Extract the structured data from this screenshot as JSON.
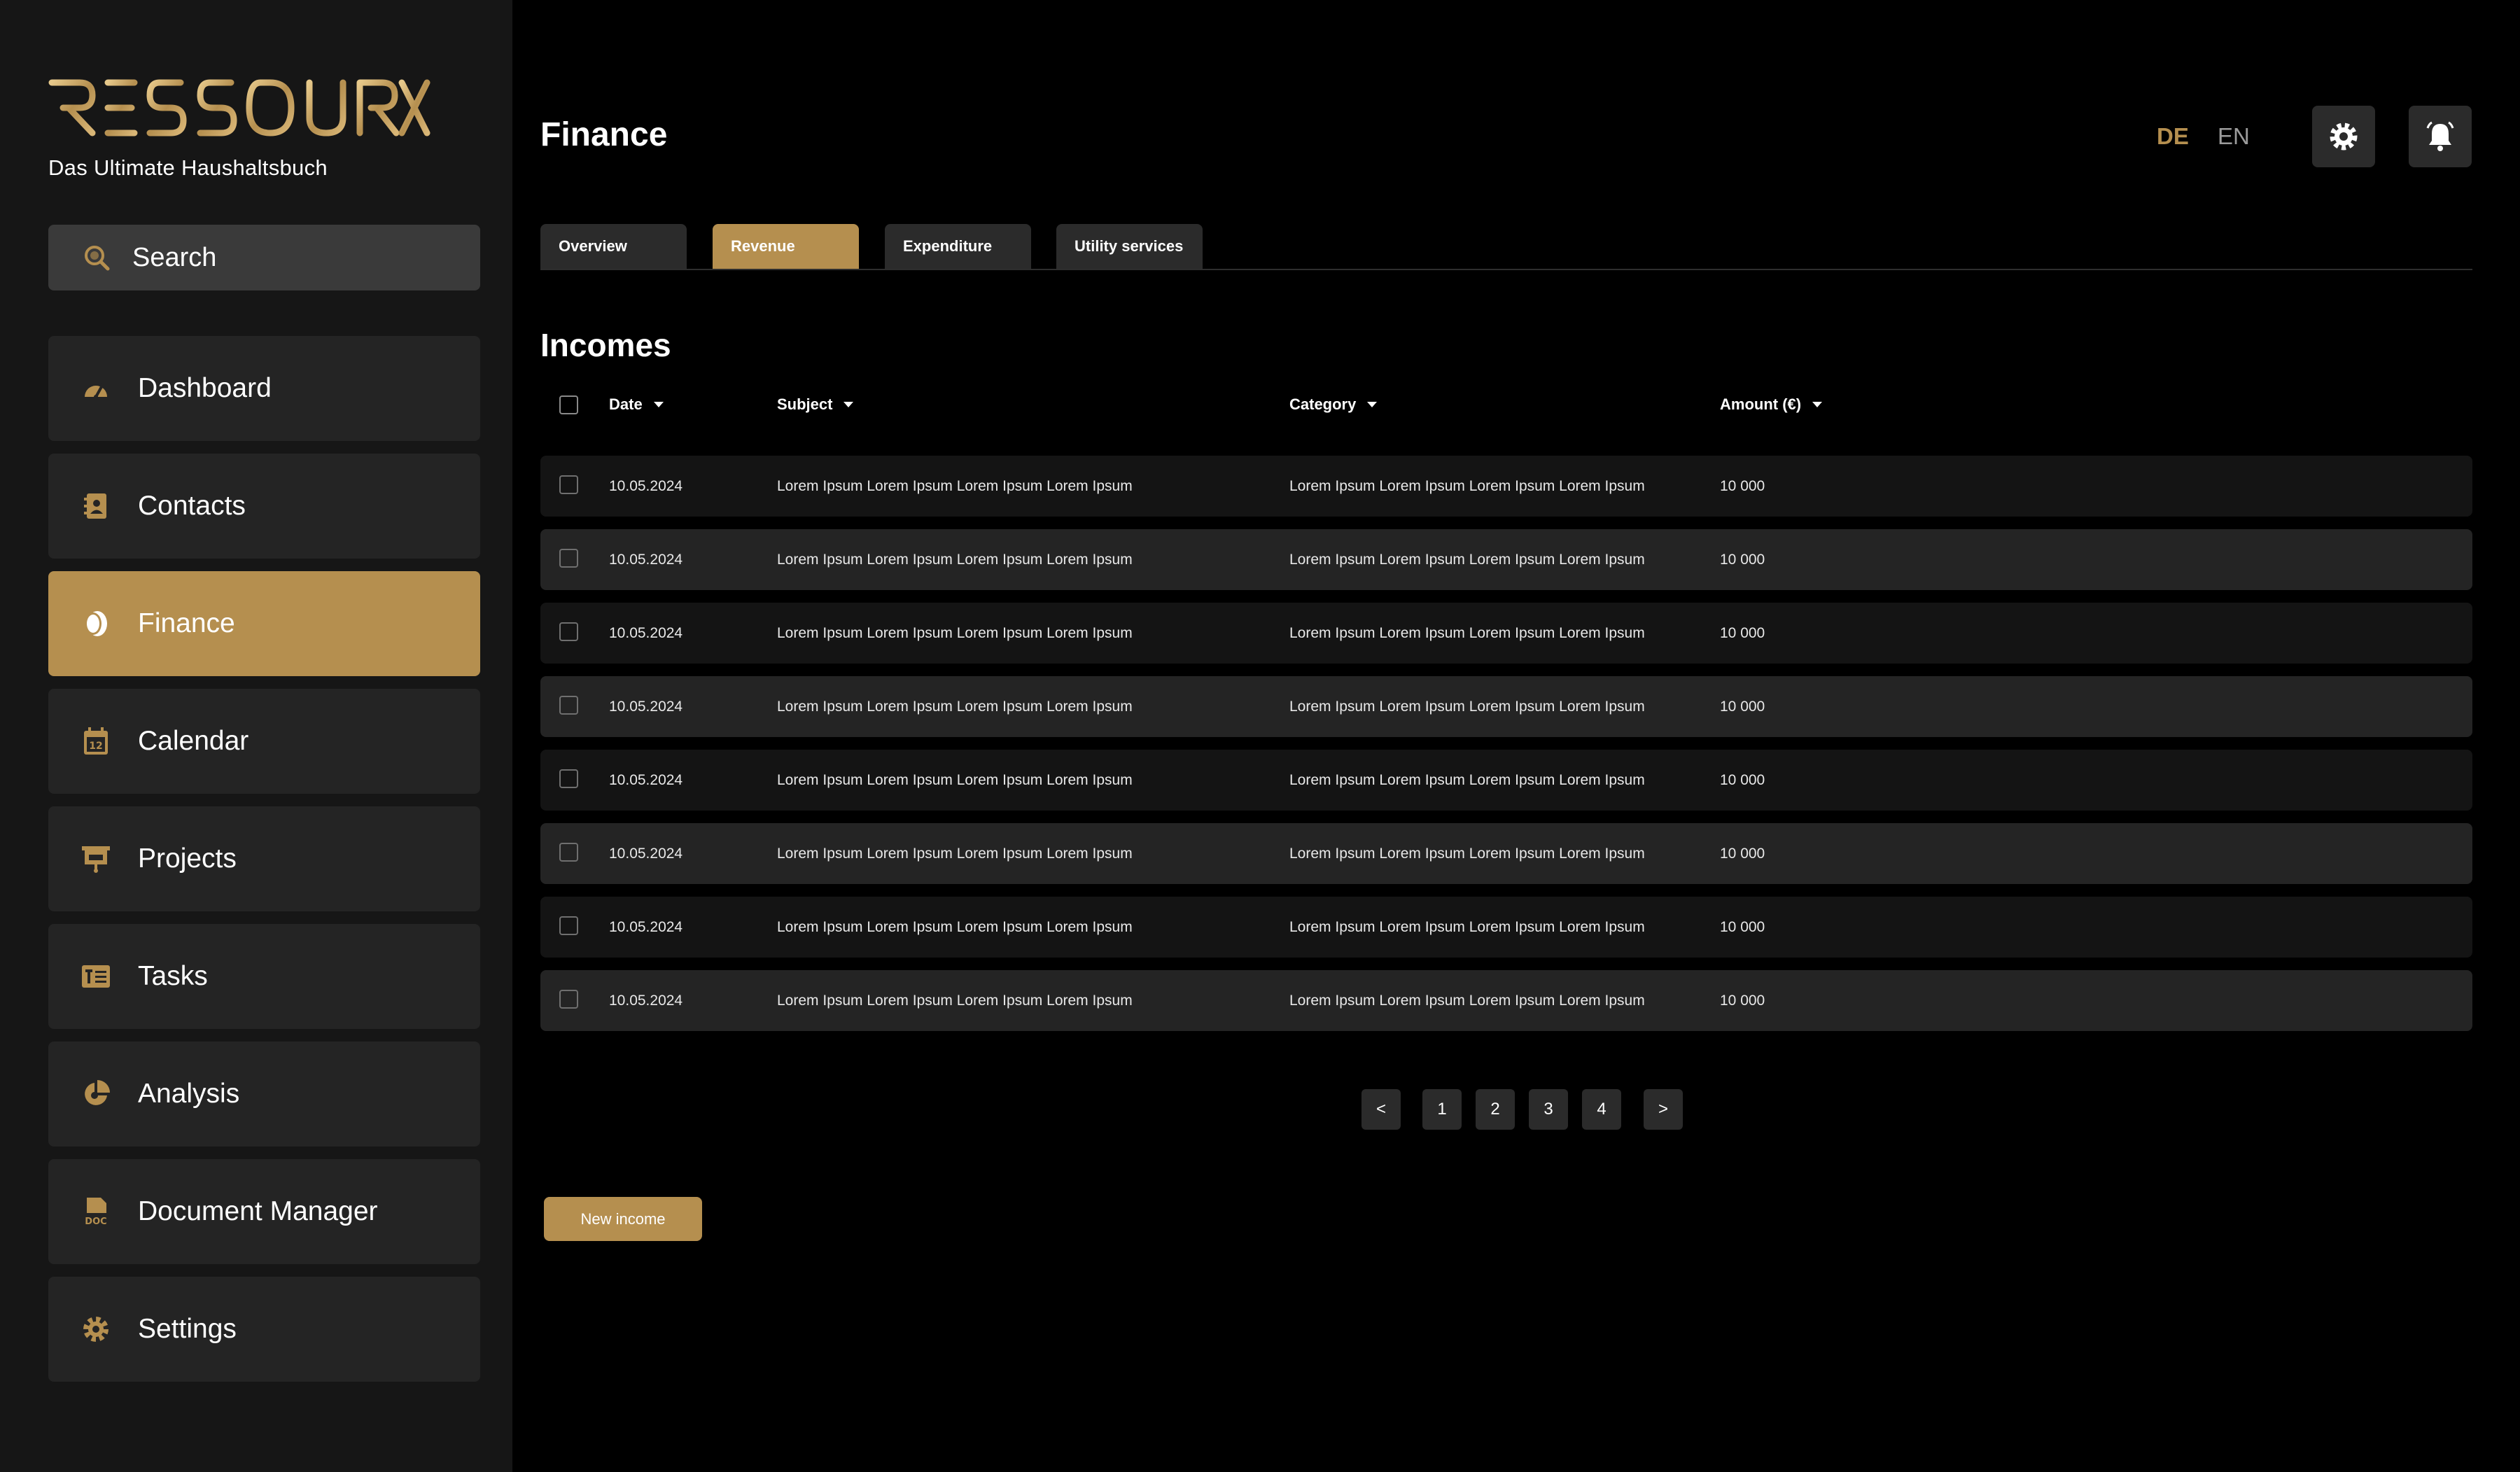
{
  "brand": {
    "logo_text": "RESSOURX",
    "tagline": "Das Ultimate Haushaltsbuch",
    "accent_color": "#b58f4f"
  },
  "search": {
    "label": "Search",
    "icon": "search-icon"
  },
  "sidebar": {
    "items": [
      {
        "label": "Dashboard",
        "icon": "dashboard-gauge-icon",
        "active": false
      },
      {
        "label": "Contacts",
        "icon": "contacts-book-icon",
        "active": false
      },
      {
        "label": "Finance",
        "icon": "finance-coins-icon",
        "active": true
      },
      {
        "label": "Calendar",
        "icon": "calendar-icon",
        "active": false
      },
      {
        "label": "Projects",
        "icon": "projects-board-icon",
        "active": false
      },
      {
        "label": "Tasks",
        "icon": "tasks-list-icon",
        "active": false
      },
      {
        "label": "Analysis",
        "icon": "analysis-pie-icon",
        "active": false
      },
      {
        "label": "Document Manager",
        "icon": "document-doc-icon",
        "active": false
      },
      {
        "label": "Settings",
        "icon": "settings-gear-icon",
        "active": false
      }
    ]
  },
  "header": {
    "title": "Finance",
    "lang_de": "DE",
    "lang_en": "EN",
    "active_lang": "DE",
    "settings_icon": "gear-icon",
    "notifications_icon": "bell-icon"
  },
  "tabs": [
    {
      "label": "Overview",
      "active": false
    },
    {
      "label": "Revenue",
      "active": true
    },
    {
      "label": "Expenditure",
      "active": false
    },
    {
      "label": "Utility services",
      "active": false
    }
  ],
  "section_title": "Incomes",
  "table": {
    "columns": [
      "Date",
      "Subject",
      "Category",
      "Amount (€)"
    ],
    "rows": [
      {
        "date": "10.05.2024",
        "subject": "Lorem Ipsum Lorem Ipsum Lorem Ipsum Lorem Ipsum",
        "category": "Lorem Ipsum Lorem Ipsum Lorem Ipsum Lorem Ipsum",
        "amount": "10 000"
      },
      {
        "date": "10.05.2024",
        "subject": "Lorem Ipsum Lorem Ipsum Lorem Ipsum Lorem Ipsum",
        "category": "Lorem Ipsum Lorem Ipsum Lorem Ipsum Lorem Ipsum",
        "amount": "10 000"
      },
      {
        "date": "10.05.2024",
        "subject": "Lorem Ipsum Lorem Ipsum Lorem Ipsum Lorem Ipsum",
        "category": "Lorem Ipsum Lorem Ipsum Lorem Ipsum Lorem Ipsum",
        "amount": "10 000"
      },
      {
        "date": "10.05.2024",
        "subject": "Lorem Ipsum Lorem Ipsum Lorem Ipsum Lorem Ipsum",
        "category": "Lorem Ipsum Lorem Ipsum Lorem Ipsum Lorem Ipsum",
        "amount": "10 000"
      },
      {
        "date": "10.05.2024",
        "subject": "Lorem Ipsum Lorem Ipsum Lorem Ipsum Lorem Ipsum",
        "category": "Lorem Ipsum Lorem Ipsum Lorem Ipsum Lorem Ipsum",
        "amount": "10 000"
      },
      {
        "date": "10.05.2024",
        "subject": "Lorem Ipsum Lorem Ipsum Lorem Ipsum Lorem Ipsum",
        "category": "Lorem Ipsum Lorem Ipsum Lorem Ipsum Lorem Ipsum",
        "amount": "10 000"
      },
      {
        "date": "10.05.2024",
        "subject": "Lorem Ipsum Lorem Ipsum Lorem Ipsum Lorem Ipsum",
        "category": "Lorem Ipsum Lorem Ipsum Lorem Ipsum Lorem Ipsum",
        "amount": "10 000"
      },
      {
        "date": "10.05.2024",
        "subject": "Lorem Ipsum Lorem Ipsum Lorem Ipsum Lorem Ipsum",
        "category": "Lorem Ipsum Lorem Ipsum Lorem Ipsum Lorem Ipsum",
        "amount": "10 000"
      }
    ]
  },
  "pagination": {
    "prev": "<",
    "pages": [
      "1",
      "2",
      "3",
      "4"
    ],
    "current": "1",
    "next": ">"
  },
  "new_button": "New income"
}
